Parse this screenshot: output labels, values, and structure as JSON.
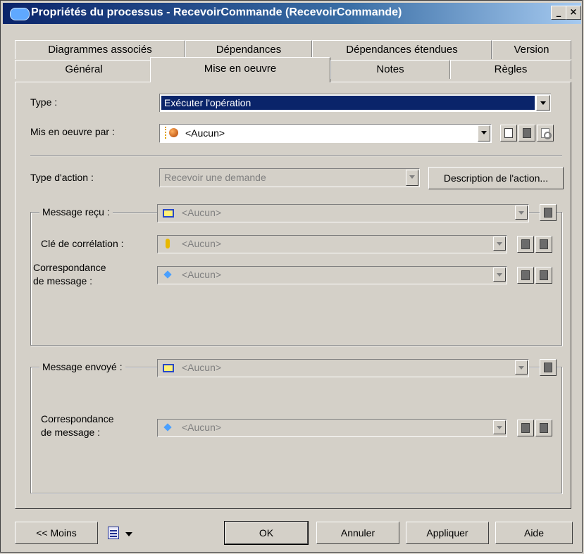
{
  "window": {
    "title": "Propriétés du processus - RecevoirCommande (RecevoirCommande)"
  },
  "tabs": {
    "row1": [
      "Diagrammes associés",
      "Dépendances",
      "Dépendances étendues",
      "Version"
    ],
    "row2": [
      "Général",
      "Mise en oeuvre",
      "Notes",
      "Règles"
    ],
    "selected": "Mise en oeuvre"
  },
  "form": {
    "type_label": "Type :",
    "type_value": "Exécuter l'opération",
    "impl_label": "Mis en oeuvre par :",
    "impl_value": "<Aucun>",
    "action_type_label": "Type d'action :",
    "action_type_value": "Recevoir une demande",
    "action_desc_button": "Description de l'action..."
  },
  "received": {
    "group_label": "Message reçu :",
    "group_value": "<Aucun>",
    "correlation_label": "Clé de corrélation :",
    "correlation_value": "<Aucun>",
    "correspondence_label_1": "Correspondance",
    "correspondence_label_2": "de message :",
    "correspondence_value": "<Aucun>"
  },
  "sent": {
    "group_label": "Message envoyé :",
    "group_value": "<Aucun>",
    "correspondence_label_1": "Correspondance",
    "correspondence_label_2": "de message :",
    "correspondence_value": "<Aucun>"
  },
  "footer": {
    "less": "<< Moins",
    "ok": "OK",
    "cancel": "Annuler",
    "apply": "Appliquer",
    "help": "Aide"
  },
  "icons": {
    "title": "window-icon",
    "impl": "object-icon",
    "message": "message-icon",
    "key": "key-icon",
    "diamond": "diamond-icon",
    "print": "print-icon"
  }
}
